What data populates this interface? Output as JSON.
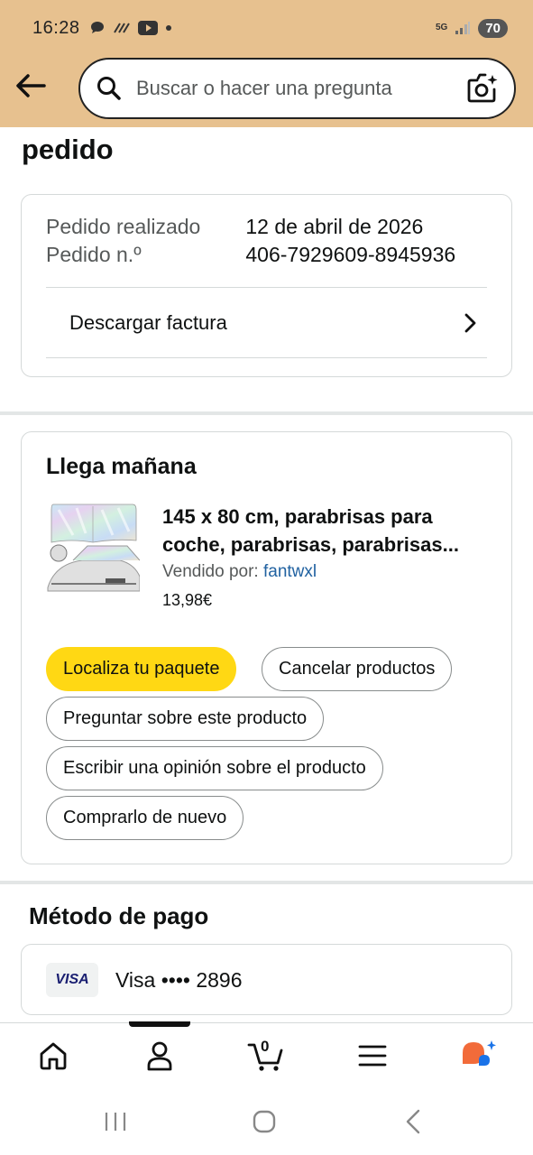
{
  "status_bar": {
    "time": "16:28",
    "network": "5G",
    "battery": "70"
  },
  "search": {
    "placeholder": "Buscar o hacer una pregunta"
  },
  "page": {
    "title": "pedido"
  },
  "order_info": {
    "placed_label": "Pedido realizado",
    "placed_value": "12 de abril de 2026",
    "number_label": "Pedido n.º",
    "number_value": "406-7929609-8945936",
    "invoice_label": "Descargar factura"
  },
  "delivery": {
    "title": "Llega mañana",
    "product_title": "145 x 80 cm, parabrisas para coche, parabrisas, parabrisas...",
    "sold_by_label": "Vendido por: ",
    "seller": "fantwxl",
    "price": "13,98€",
    "actions": {
      "track": "Localiza tu paquete",
      "cancel": "Cancelar productos",
      "ask": "Preguntar sobre este producto",
      "review": "Escribir una opinión sobre el producto",
      "buy_again": "Comprarlo de nuevo"
    }
  },
  "payment": {
    "title": "Método de pago",
    "card_brand": "VISA",
    "card_text": "Visa •••• 2896"
  },
  "bottom_nav": {
    "cart_count": "0",
    "icons": [
      "home-icon",
      "account-icon",
      "cart-icon",
      "menu-icon",
      "assistant-icon"
    ]
  },
  "colors": {
    "header_bg": "#e7c18f",
    "primary_button": "#ffd814",
    "link": "#2162a1"
  }
}
